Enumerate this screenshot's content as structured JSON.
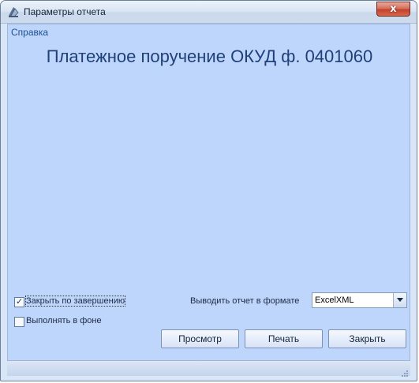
{
  "window": {
    "title": "Параметры отчета",
    "close_label": "x",
    "colors": {
      "accent": "#1f3f7d",
      "client_bg": "#bed6fb",
      "close": "#c4412b"
    }
  },
  "menu": {
    "help": "Справка"
  },
  "report": {
    "title": "Платежное поручение ОКУД ф. 0401060"
  },
  "options": {
    "close_on_finish": {
      "label": "Закрыть по завершению",
      "checked": true
    },
    "run_in_background": {
      "label": "Выполнять в фоне",
      "checked": false
    }
  },
  "output_format": {
    "label": "Выводить отчет в формате",
    "value": "ExcelXML"
  },
  "buttons": {
    "preview": "Просмотр",
    "print": "Печать",
    "close": "Закрыть"
  },
  "icons": {
    "app": "report-wizard-icon",
    "dropdown": "chevron-down-icon",
    "grip": "resize-grip-icon"
  }
}
